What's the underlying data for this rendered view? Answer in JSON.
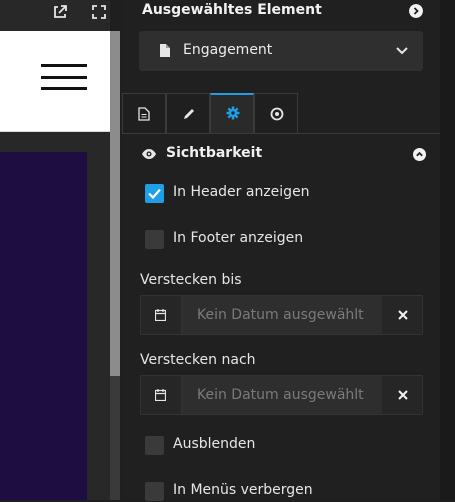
{
  "panel": {
    "title": "Ausgewähltes Element",
    "selected_element": "Engagement"
  },
  "tabs": [
    {
      "icon": "document-icon",
      "active": false
    },
    {
      "icon": "pencil-icon",
      "active": false
    },
    {
      "icon": "gear-icon",
      "active": true
    },
    {
      "icon": "target-icon",
      "active": false
    }
  ],
  "visibility": {
    "title": "Sichtbarkeit",
    "show_in_header": {
      "label": "In Header anzeigen",
      "checked": true
    },
    "show_in_footer": {
      "label": "In Footer anzeigen",
      "checked": false
    },
    "hide_until": {
      "label": "Verstecken bis",
      "placeholder": "Kein Datum ausgewählt"
    },
    "hide_after": {
      "label": "Verstecken nach",
      "placeholder": "Kein Datum ausgewählt"
    },
    "hide": {
      "label": "Ausblenden",
      "checked": false
    },
    "hide_in_menus": {
      "label": "In Menüs verbergen",
      "checked": false
    }
  },
  "colors": {
    "accent": "#1e9fe6",
    "panel_bg": "#202020",
    "preview_purple": "#1e0d40"
  }
}
